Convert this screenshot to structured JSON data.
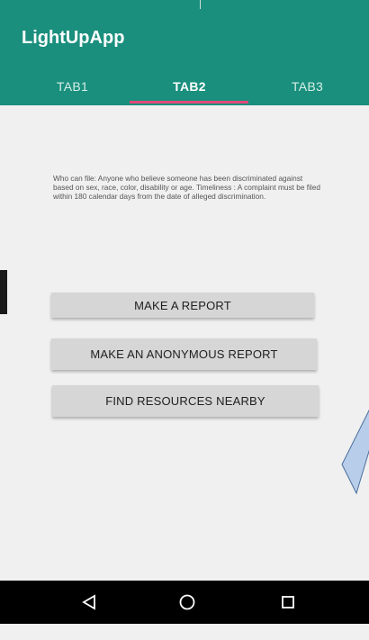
{
  "app": {
    "title": "LightUpApp",
    "accent_color": "#1a8f7d",
    "indicator_color": "#e2487a"
  },
  "tabs": [
    {
      "label": "TAB1",
      "active": false
    },
    {
      "label": "TAB2",
      "active": true
    },
    {
      "label": "TAB3",
      "active": false
    }
  ],
  "main": {
    "info_text": "Who can file: Anyone who believe someone has been discriminated against based on sex, race, color, disability or age.   Timeliness : A complaint must be filed within 180 calendar days from the date of alleged discrimination.",
    "buttons": {
      "make_report": "MAKE A REPORT",
      "make_anonymous_report": "MAKE AN ANONYMOUS REPORT",
      "find_resources": "FIND RESOURCES NEARBY"
    }
  },
  "navigation_bar": {
    "icons": [
      "back-triangle-icon",
      "home-circle-icon",
      "recents-square-icon"
    ]
  }
}
